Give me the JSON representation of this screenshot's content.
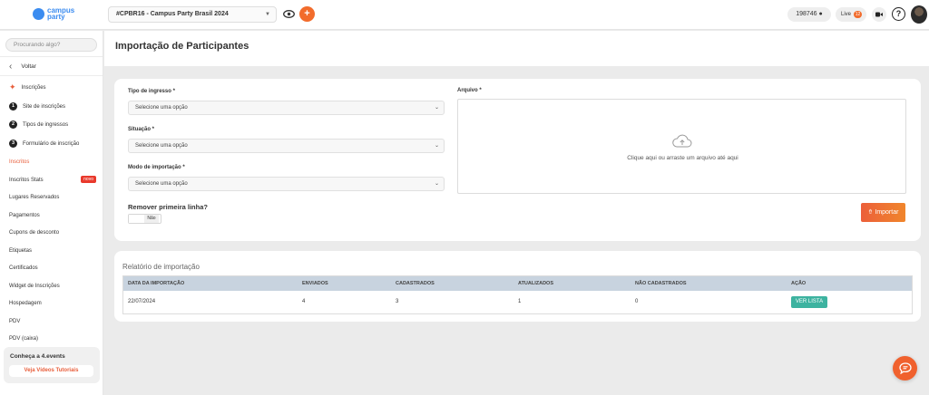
{
  "brand": {
    "logo_text": "campus party",
    "accent": "#f26c2c",
    "link_color": "#3b8cf0"
  },
  "topbar": {
    "event_selected": "#CPBR16 - Campus Party Brasil 2024",
    "add_button": "+",
    "count": "198746",
    "live_label": "Live",
    "live_badge": "12",
    "help": "?"
  },
  "sidebar": {
    "search_placeholder": "Procurando algo?",
    "back_label": "Voltar",
    "section_title": "Inscrições",
    "steps": [
      {
        "num": "1",
        "label": "Site de inscrições"
      },
      {
        "num": "2",
        "label": "Tipos de ingressos"
      },
      {
        "num": "3",
        "label": "Formulário de inscrição"
      }
    ],
    "items": [
      {
        "label": "Inscritos"
      },
      {
        "label": "Inscritos Stats",
        "badge": "novo"
      },
      {
        "label": "Lugares Reservados"
      },
      {
        "label": "Pagamentos"
      },
      {
        "label": "Cupons de desconto"
      },
      {
        "label": "Etiquetas"
      },
      {
        "label": "Certificados"
      },
      {
        "label": "Widget de Inscrições"
      },
      {
        "label": "Hospedagem"
      },
      {
        "label": "PDV"
      },
      {
        "label": "PDV (caixa)"
      }
    ],
    "promo_title": "Conheça a 4.events",
    "promo_button": "Veja Vídeos Tutoriais"
  },
  "page": {
    "title": "Importação de Participantes"
  },
  "form": {
    "ticket_type_label": "Tipo de ingresso *",
    "ticket_type_value": "Selecione uma opção",
    "status_label": "Situação *",
    "status_value": "Selecione uma opção",
    "mode_label": "Modo de importação *",
    "mode_value": "Selecione uma opção",
    "remove_first_line_label": "Remover primeira linha?",
    "toggle_label": "Não",
    "file_label": "Arquivo *",
    "drop_text": "Clique aqui ou arraste um arquivo até aqui",
    "import_button": "Importar"
  },
  "report": {
    "title": "Relatório de importação",
    "columns": [
      "Data da importação",
      "Enviados",
      "Cadastrados",
      "Atualizados",
      "Não cadastrados",
      "Ação"
    ],
    "rows": [
      {
        "date": "22/07/2024",
        "sent": "4",
        "registered": "3",
        "updated": "1",
        "not_registered": "0",
        "action": "VER LISTA"
      }
    ]
  }
}
